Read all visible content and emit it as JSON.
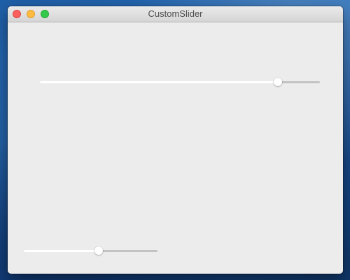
{
  "window": {
    "title": "CustomSlider"
  },
  "sliders": [
    {
      "id": "top",
      "value": 0.85
    },
    {
      "id": "bottom",
      "value": 0.56
    }
  ],
  "colors": {
    "track_filled": "#ffffff",
    "track_empty": "#c3c3c3",
    "close": "#fc605c",
    "minimize": "#fdbc40",
    "zoom": "#34c84a"
  }
}
